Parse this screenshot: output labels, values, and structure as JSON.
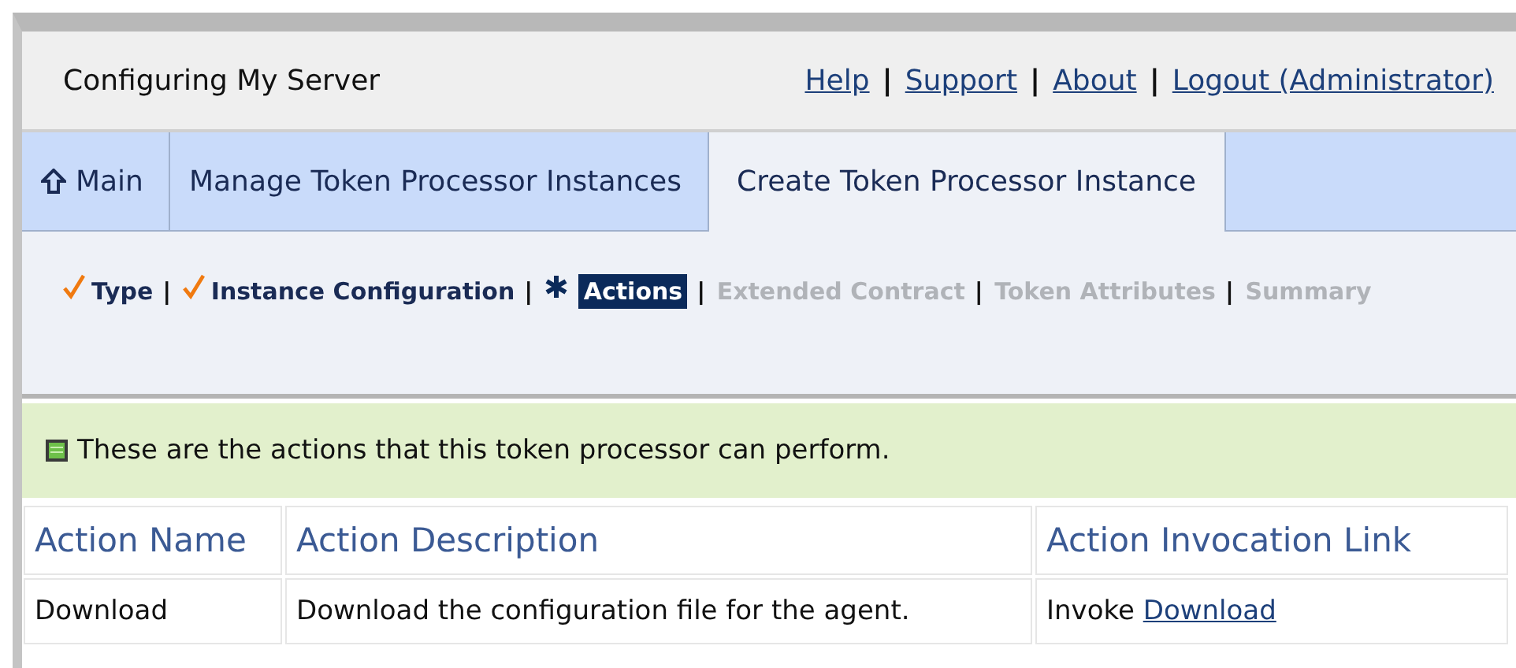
{
  "header": {
    "title": "Configuring My Server",
    "links": [
      "Help",
      "Support",
      "About",
      "Logout (Administrator)"
    ],
    "separator": "|"
  },
  "tabs": [
    {
      "label": "Main",
      "kind": "home",
      "selected": false
    },
    {
      "label": "Manage Token Processor Instances",
      "kind": "plain",
      "selected": false
    },
    {
      "label": "Create Token Processor Instance",
      "kind": "plain",
      "selected": true
    }
  ],
  "steps": {
    "separator": "|",
    "items": [
      {
        "label": "Type",
        "completed": true,
        "selected": false
      },
      {
        "label": "Instance Configuration",
        "completed": true,
        "selected": false
      },
      {
        "label": "Actions",
        "completed": false,
        "selected": true
      },
      {
        "label": "Extended Contract",
        "completed": false,
        "selected": false
      },
      {
        "label": "Token Attributes",
        "completed": false,
        "selected": false
      },
      {
        "label": "Summary",
        "completed": false,
        "selected": false
      }
    ]
  },
  "message": "These are the actions that this token processor can perform.",
  "table": {
    "columns": [
      "Action Name",
      "Action Description",
      "Action Invocation Link"
    ],
    "rows": [
      {
        "name": "Download",
        "description": "Download the configuration file for the agent.",
        "invoke_text": "Invoke",
        "invoke_link": "Download"
      }
    ]
  }
}
